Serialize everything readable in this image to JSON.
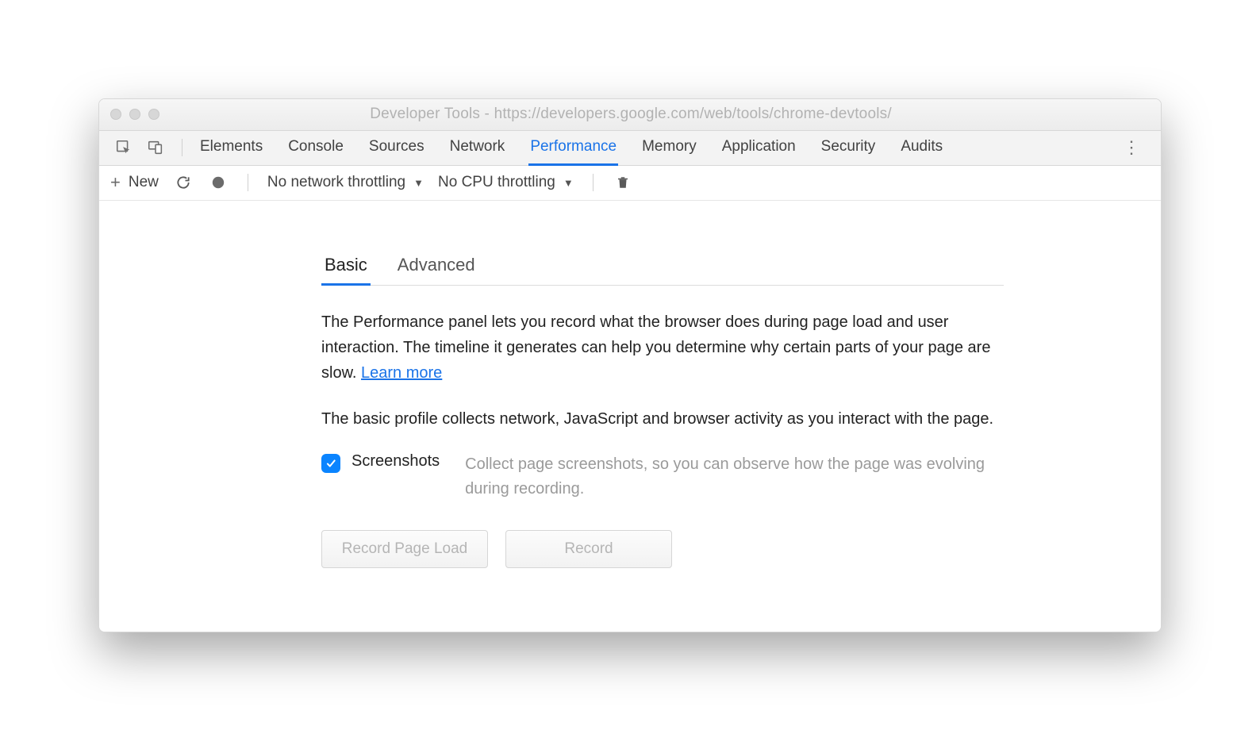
{
  "window": {
    "title": "Developer Tools - https://developers.google.com/web/tools/chrome-devtools/"
  },
  "tabs": [
    {
      "label": "Elements",
      "active": false
    },
    {
      "label": "Console",
      "active": false
    },
    {
      "label": "Sources",
      "active": false
    },
    {
      "label": "Network",
      "active": false
    },
    {
      "label": "Performance",
      "active": true
    },
    {
      "label": "Memory",
      "active": false
    },
    {
      "label": "Application",
      "active": false
    },
    {
      "label": "Security",
      "active": false
    },
    {
      "label": "Audits",
      "active": false
    }
  ],
  "toolbar": {
    "new_label": "New",
    "network_throttle": "No network throttling",
    "cpu_throttle": "No CPU throttling"
  },
  "sub_tabs": [
    {
      "label": "Basic",
      "active": true
    },
    {
      "label": "Advanced",
      "active": false
    }
  ],
  "description": {
    "para1_a": "The Performance panel lets you record what the browser does during page load and user interaction. The timeline it generates can help you determine why certain parts of your page are slow.  ",
    "learn_more": "Learn more",
    "para2": "The basic profile collects network, JavaScript and browser activity as you interact with the page."
  },
  "option": {
    "checked": true,
    "label": "Screenshots",
    "desc": "Collect page screenshots, so you can observe how the page was evolving during recording."
  },
  "buttons": {
    "record_page_load": "Record Page Load",
    "record": "Record"
  }
}
